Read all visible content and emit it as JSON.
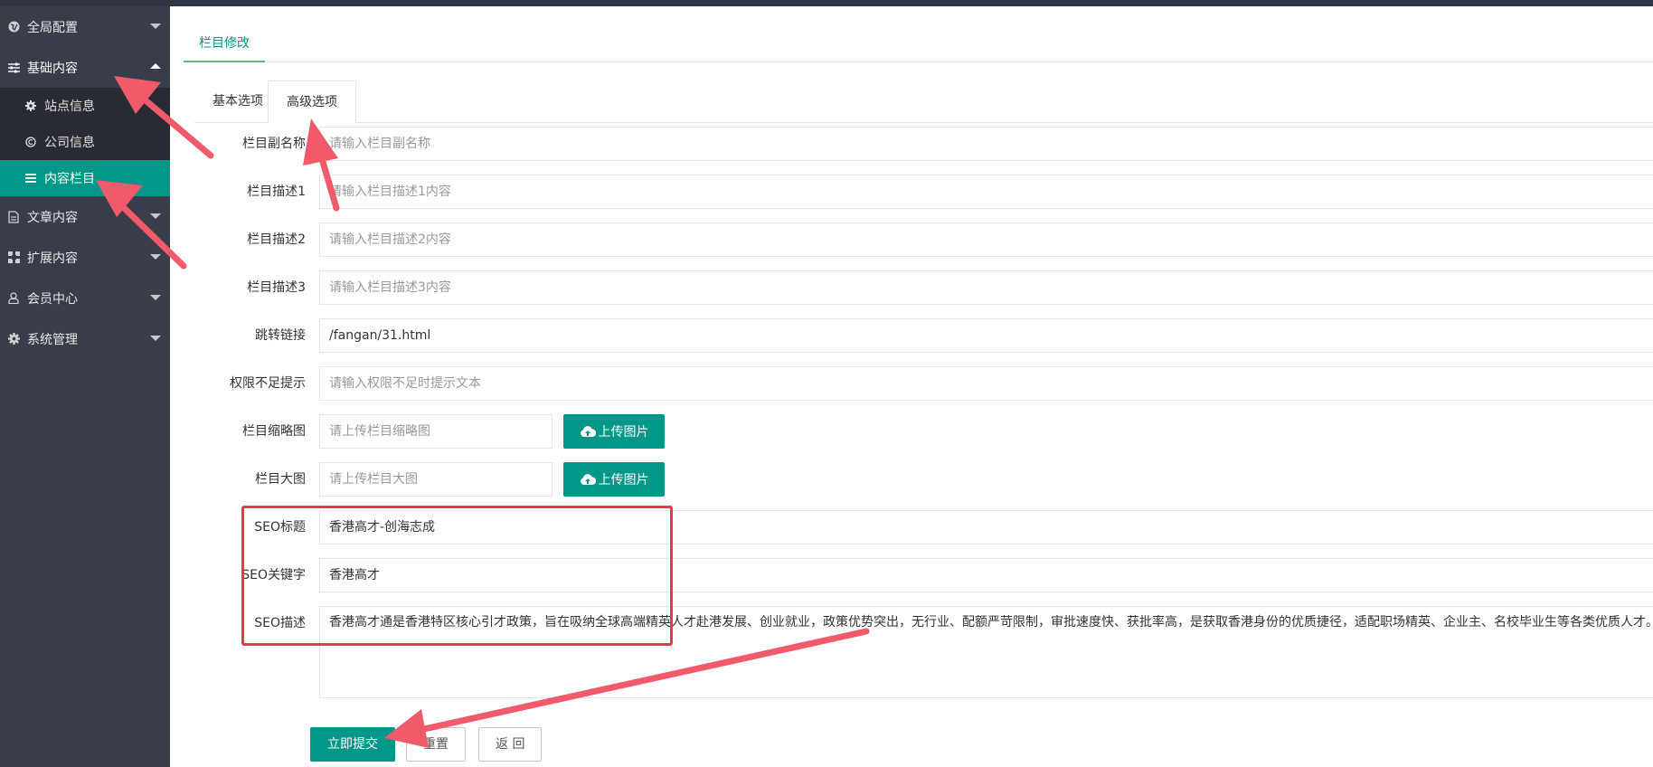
{
  "sidebar": {
    "items": [
      {
        "label": "全局配置",
        "icon": "globe-icon"
      },
      {
        "label": "基础内容",
        "icon": "sliders-icon"
      },
      {
        "label": "文章内容",
        "icon": "document-icon"
      },
      {
        "label": "扩展内容",
        "icon": "expand-icon"
      },
      {
        "label": "会员中心",
        "icon": "user-icon"
      },
      {
        "label": "系统管理",
        "icon": "gear-icon"
      }
    ],
    "subitems": [
      {
        "label": "站点信息",
        "icon": "gear-icon"
      },
      {
        "label": "公司信息",
        "icon": "copyright-icon"
      },
      {
        "label": "内容栏目",
        "icon": "list-icon"
      }
    ]
  },
  "page_tab": {
    "label": "栏目修改"
  },
  "form_tabs": {
    "basic": "基本选项",
    "advanced": "高级选项"
  },
  "form": {
    "subname": {
      "label": "栏目副名称",
      "placeholder": "请输入栏目副名称"
    },
    "desc1": {
      "label": "栏目描述1",
      "placeholder": "请输入栏目描述1内容"
    },
    "desc2": {
      "label": "栏目描述2",
      "placeholder": "请输入栏目描述2内容"
    },
    "desc3": {
      "label": "栏目描述3",
      "placeholder": "请输入栏目描述3内容"
    },
    "link": {
      "label": "跳转链接",
      "value": "/fangan/31.html"
    },
    "denied": {
      "label": "权限不足提示",
      "placeholder": "请输入权限不足时提示文本"
    },
    "thumb": {
      "label": "栏目缩略图",
      "placeholder": "请上传栏目缩略图",
      "button": "上传图片"
    },
    "bigimg": {
      "label": "栏目大图",
      "placeholder": "请上传栏目大图",
      "button": "上传图片"
    },
    "seo_title": {
      "label": "SEO标题",
      "value": "香港高才-创海志成"
    },
    "seo_keywords": {
      "label": "SEO关键字",
      "value": "香港高才"
    },
    "seo_desc": {
      "label": "SEO描述",
      "value": "香港高才通是香港特区核心引才政策，旨在吸纳全球高端精英人才赴港发展、创业就业，政策优势突出，无行业、配额严苛限制，审批速度快、获批率高，是获取香港身份的优质捷径，适配职场精英、企业主、名校毕业生等各类优质人才。"
    }
  },
  "actions": {
    "submit": "立即提交",
    "reset": "重置",
    "back": "返 回"
  },
  "colors": {
    "accent": "#009688",
    "sidebar": "#393d49",
    "annotation": "#e8394d"
  }
}
